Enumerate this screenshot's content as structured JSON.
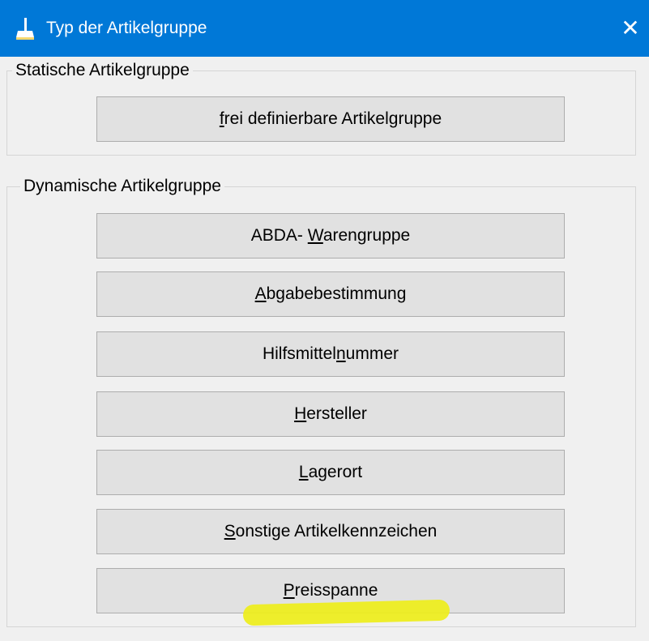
{
  "window": {
    "title": "Typ der Artikelgruppe",
    "title_icon": "broom-icon",
    "close_glyph": "✕",
    "titlebar_color": "#0078d7"
  },
  "static_group": {
    "label": "Statische Artikelgruppe",
    "buttons": [
      {
        "mnemonic": "f",
        "rest": "rei definierbare Artikelgruppe"
      }
    ]
  },
  "dynamic_group": {
    "label": "Dynamische Artikelgruppe",
    "buttons": [
      {
        "before": "ABDA- ",
        "mnemonic": "W",
        "rest": "arengruppe"
      },
      {
        "before": "",
        "mnemonic": "A",
        "rest": "bgabebestimmung"
      },
      {
        "before": "Hilfsmittel",
        "mnemonic": "n",
        "rest": "ummer"
      },
      {
        "before": "",
        "mnemonic": "H",
        "rest": "ersteller"
      },
      {
        "before": "",
        "mnemonic": "L",
        "rest": "agerort"
      },
      {
        "before": "",
        "mnemonic": "S",
        "rest": "onstige Artikelkennzeichen"
      },
      {
        "before": "",
        "mnemonic": "P",
        "rest": "reisspanne"
      }
    ],
    "highlight_color": "#eeee1a"
  }
}
